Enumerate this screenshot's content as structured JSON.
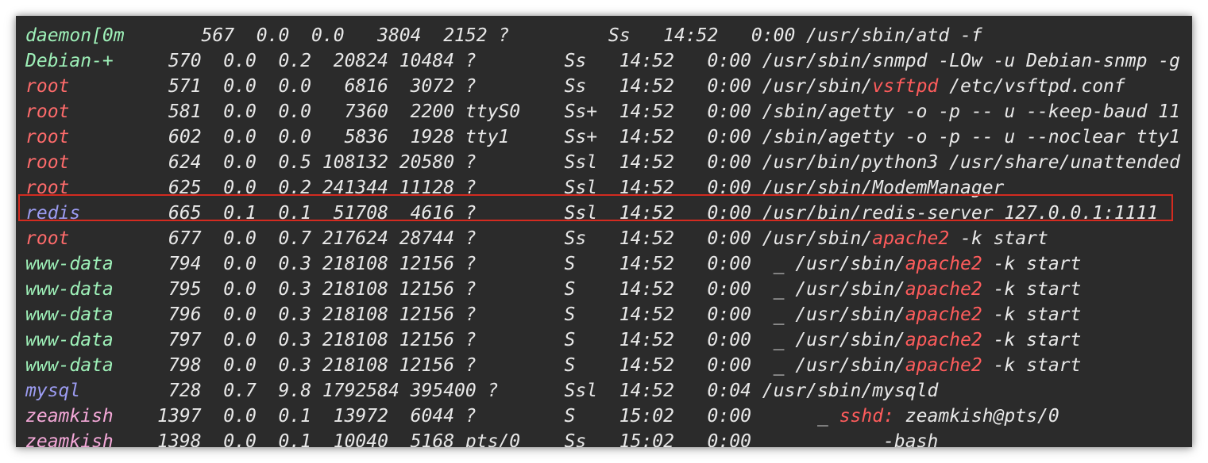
{
  "colors": {
    "background": "#2b2b2b",
    "text": "#e8e8e8",
    "user_green": "#9ef0b8",
    "user_red": "#ff6b6b",
    "user_blue": "#9c9cf2",
    "user_pink": "#f4a8d8",
    "highlight_text": "#ff5c5c",
    "highlight_box": "#d42b20"
  },
  "rows": [
    {
      "user": "daemon[0m",
      "user_color": "green",
      "rest": "       567  0.0  0.0   3804  2152 ?         Ss   14:52   0:00 /usr/sbin/atd -f",
      "cmd_pre": "",
      "cmd_hl": "",
      "cmd_post": ""
    },
    {
      "user": "Debian-+",
      "user_color": "green",
      "rest": "     570  0.0  0.2  20824 10484 ?        Ss   14:52   0:00 /usr/sbin/snmpd -LOw -u Debian-snmp -g",
      "cmd_pre": "",
      "cmd_hl": "",
      "cmd_post": ""
    },
    {
      "user": "root",
      "user_color": "red",
      "rest": "         571  0.0  0.0   6816  3072 ?        Ss   14:52   0:00 ",
      "cmd_pre": "/usr/sbin/",
      "cmd_hl": "vsftpd",
      "cmd_post": " /etc/vsftpd.conf"
    },
    {
      "user": "root",
      "user_color": "red",
      "rest": "         581  0.0  0.0   7360  2200 ttyS0    Ss+  14:52   0:00 /sbin/agetty -o -p -- u --keep-baud 11",
      "cmd_pre": "",
      "cmd_hl": "",
      "cmd_post": ""
    },
    {
      "user": "root",
      "user_color": "red",
      "rest": "         602  0.0  0.0   5836  1928 tty1     Ss+  14:52   0:00 /sbin/agetty -o -p -- u --noclear tty1",
      "cmd_pre": "",
      "cmd_hl": "",
      "cmd_post": ""
    },
    {
      "user": "root",
      "user_color": "red",
      "rest": "         624  0.0  0.5 108132 20580 ?        Ssl  14:52   0:00 /usr/bin/python3 /usr/share/unattended",
      "cmd_pre": "",
      "cmd_hl": "",
      "cmd_post": ""
    },
    {
      "user": "root",
      "user_color": "red",
      "rest": "         625  0.0  0.2 241344 11128 ?        Ssl  14:52   0:00 /usr/sbin/ModemManager",
      "cmd_pre": "",
      "cmd_hl": "",
      "cmd_post": ""
    },
    {
      "user": "redis",
      "user_color": "blue",
      "rest": "        665  0.1  0.1  51708  4616 ?        Ssl  14:52   0:00 /usr/bin/redis-server 127.0.0.1:1111",
      "cmd_pre": "",
      "cmd_hl": "",
      "cmd_post": ""
    },
    {
      "user": "root",
      "user_color": "red",
      "rest": "         677  0.0  0.7 217624 28744 ?        Ss   14:52   0:00 ",
      "cmd_pre": "/usr/sbin/",
      "cmd_hl": "apache2",
      "cmd_post": " -k start"
    },
    {
      "user": "www-data",
      "user_color": "green",
      "rest": "     794  0.0  0.3 218108 12156 ?        S    14:52   0:00  _ ",
      "cmd_pre": "/usr/sbin/",
      "cmd_hl": "apache2",
      "cmd_post": " -k start"
    },
    {
      "user": "www-data",
      "user_color": "green",
      "rest": "     795  0.0  0.3 218108 12156 ?        S    14:52   0:00  _ ",
      "cmd_pre": "/usr/sbin/",
      "cmd_hl": "apache2",
      "cmd_post": " -k start"
    },
    {
      "user": "www-data",
      "user_color": "green",
      "rest": "     796  0.0  0.3 218108 12156 ?        S    14:52   0:00  _ ",
      "cmd_pre": "/usr/sbin/",
      "cmd_hl": "apache2",
      "cmd_post": " -k start"
    },
    {
      "user": "www-data",
      "user_color": "green",
      "rest": "     797  0.0  0.3 218108 12156 ?        S    14:52   0:00  _ ",
      "cmd_pre": "/usr/sbin/",
      "cmd_hl": "apache2",
      "cmd_post": " -k start"
    },
    {
      "user": "www-data",
      "user_color": "green",
      "rest": "     798  0.0  0.3 218108 12156 ?        S    14:52   0:00  _ ",
      "cmd_pre": "/usr/sbin/",
      "cmd_hl": "apache2",
      "cmd_post": " -k start"
    },
    {
      "user": "mysql",
      "user_color": "blue",
      "rest": "        728  0.7  9.8 1792584 395400 ?      Ssl  14:52   0:04 /usr/sbin/mysqld",
      "cmd_pre": "",
      "cmd_hl": "",
      "cmd_post": ""
    },
    {
      "user": "zeamkish",
      "user_color": "pink",
      "rest": "    1397  0.0  0.1  13972  6044 ?        S    15:02   0:00      _ ",
      "cmd_pre": "",
      "cmd_hl": "sshd:",
      "cmd_post": " zeamkish@pts/0"
    },
    {
      "user": "zeamkish",
      "user_color": "pink",
      "rest": "    1398  0.0  0.1  10040  5168 pts/0    Ss   15:02   0:00          _ -bash",
      "cmd_pre": "",
      "cmd_hl": "",
      "cmd_post": ""
    }
  ]
}
